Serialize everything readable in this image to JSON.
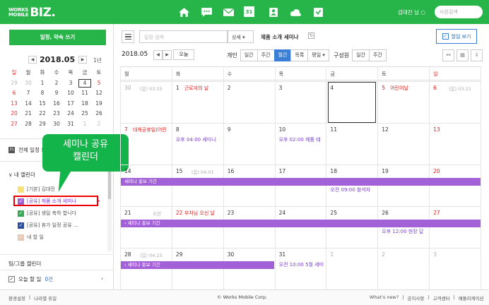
{
  "logo": {
    "line1": "WORKS",
    "line2": "MOBILE",
    "biz": "BIZ."
  },
  "topbar": {
    "icons": [
      "home-icon",
      "chat-icon",
      "mail-icon",
      "calendar-icon",
      "contacts-icon",
      "drive-icon",
      "board-icon"
    ],
    "calendar_day": "31",
    "user": "김대진 님 ○",
    "search_placeholder": "사원검색"
  },
  "sidebar": {
    "new_button": "일정, 약속 쓰기",
    "mini_title": "2018.05",
    "year_link": "1년",
    "mini_days": [
      "일",
      "월",
      "화",
      "수",
      "목",
      "금",
      "토"
    ],
    "mini_weeks": [
      [
        "29",
        "30",
        "1",
        "2",
        "3",
        "4",
        "5"
      ],
      [
        "6",
        "7",
        "8",
        "9",
        "10",
        "11",
        "12"
      ],
      [
        "13",
        "14",
        "15",
        "16",
        "17",
        "18",
        "19"
      ],
      [
        "20",
        "21",
        "22",
        "23",
        "24",
        "25",
        "26"
      ],
      [
        "27",
        "28",
        "29",
        "30",
        "31",
        "1",
        "2"
      ]
    ],
    "all_calendars": "전체 일정 보기",
    "my_calendars": "∨ 내 캘린더",
    "items": [
      {
        "label": "[기본] 김대진",
        "color": "#f5e07a"
      },
      {
        "label": "[공유] 제품 소개 세미나",
        "color": "#a361d8",
        "checked": true
      },
      {
        "label": "[공유] 생일 축하 합니다",
        "color": "#35a853",
        "checked": true
      },
      {
        "label": "[공유] 휴가 일정 공유 ...",
        "color": "#2c4f9e",
        "checked": true
      },
      {
        "label": "내 할 일",
        "color": "#e8c8b0",
        "checked": true
      }
    ],
    "group_calendars": "팀/그룹 캘린더",
    "today_todo": "오늘 할 일",
    "today_count": "0건",
    "tooltip_line1": "세미나 공유",
    "tooltip_line2": "캘린더"
  },
  "toolbar": {
    "search_placeholder": "일정 검색",
    "detail": "상세 ▾",
    "calendar_title": "제품 소개 세미나",
    "todo_button": "할일 보기",
    "current_month": "2018.05",
    "today": "오늘",
    "personal_label": "개인",
    "personal_tabs": [
      "일간",
      "주간",
      "월간",
      "목록",
      "평일 ▾"
    ],
    "members_label": "구성원",
    "members_tabs": [
      "일간",
      "주간"
    ]
  },
  "grid": {
    "dow": [
      "월",
      "화",
      "수",
      "목",
      "금",
      "토",
      "일"
    ],
    "weeks": [
      [
        {
          "n": "30",
          "gray": true,
          "lunar": "(음) 03.15"
        },
        {
          "n": "1",
          "hol": "근로자의 날"
        },
        {
          "n": "2"
        },
        {
          "n": "3"
        },
        {
          "n": "4"
        },
        {
          "n": "5",
          "red": true,
          "hol": "어린이날"
        },
        {
          "n": "6",
          "red": true,
          "lunar": "(음) 03.21"
        }
      ],
      [
        {
          "n": "7",
          "red": true,
          "hol": "대체공휴일(어린"
        },
        {
          "n": "8",
          "ev": "오후 04:00 세미나"
        },
        {
          "n": "9"
        },
        {
          "n": "10",
          "ev": "오후 02:00 제품 테"
        },
        {
          "n": "11"
        },
        {
          "n": "12"
        },
        {
          "n": "13",
          "red": true
        }
      ],
      [
        {
          "n": "14"
        },
        {
          "n": "15",
          "lunar": "(음) 04.01"
        },
        {
          "n": "16"
        },
        {
          "n": "17"
        },
        {
          "n": "18",
          "ev2": "오전 09:00 참석자"
        },
        {
          "n": "19"
        },
        {
          "n": "20",
          "red": true
        }
      ],
      [
        {
          "n": "21",
          "lunar2": "소만"
        },
        {
          "n": "22",
          "red": true,
          "hol": "부처님 오신 날"
        },
        {
          "n": "23"
        },
        {
          "n": "24"
        },
        {
          "n": "25"
        },
        {
          "n": "26",
          "ev2": "오후 12:00 현장 답"
        },
        {
          "n": "27",
          "red": true
        }
      ],
      [
        {
          "n": "28",
          "lunar": "(음) 04.15"
        },
        {
          "n": "29"
        },
        {
          "n": "30"
        },
        {
          "n": "31",
          "ev": "오전 10:00 5월 세미"
        },
        {
          "n": "1",
          "gray": true
        },
        {
          "n": "2",
          "gray": true
        },
        {
          "n": "3",
          "gray": true
        }
      ]
    ],
    "bar1": "세미나 홍보 기간",
    "bar2": "‹ 세미나 홍보 기간",
    "bar3": "‹ 세미나 홍보 기간"
  },
  "footer": {
    "left": [
      "환경설정",
      "나라별 휴일"
    ],
    "center": "© Works Mobile Corp.",
    "right": [
      "What's new?",
      "공지사항",
      "고객센터",
      "애플리케이션"
    ]
  }
}
